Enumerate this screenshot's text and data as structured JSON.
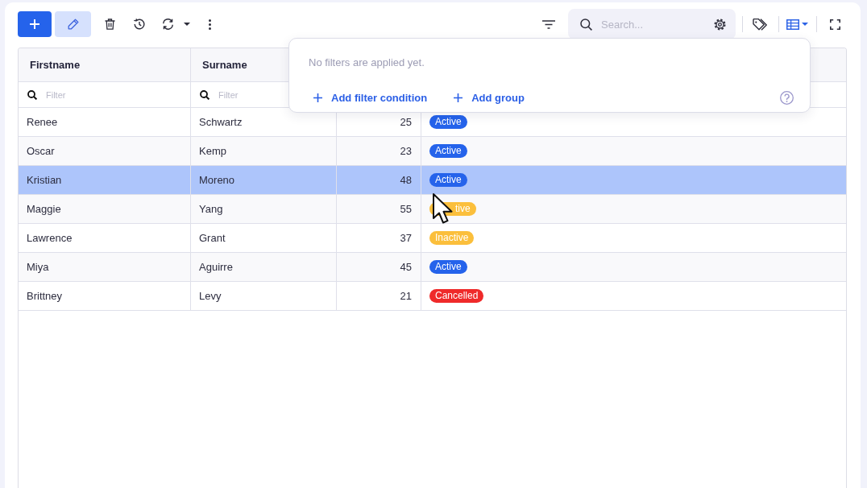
{
  "toolbar": {
    "search": {
      "placeholder": "Search..."
    }
  },
  "filter_popup": {
    "message": "No filters are applied yet.",
    "actions": [
      {
        "label": "Add filter condition"
      },
      {
        "label": "Add group"
      }
    ]
  },
  "table": {
    "columns": [
      {
        "label": "Firstname",
        "filter_placeholder": "Filter"
      },
      {
        "label": "Surname",
        "filter_placeholder": "Filter"
      }
    ],
    "rows": [
      {
        "firstname": "Renee",
        "surname": "Schwartz",
        "column_3": "25",
        "column_4": {
          "label": "Active",
          "color": "#2563eb",
          "covered": false
        },
        "selected": false
      },
      {
        "firstname": "Oscar",
        "surname": "Kemp",
        "column_3": "23",
        "column_4": {
          "label": "Active",
          "color": "#2563eb",
          "covered": false
        },
        "selected": false
      },
      {
        "firstname": "Kristian",
        "surname": "Moreno",
        "column_3": "48",
        "column_4": {
          "label": "Active",
          "color": "#2563eb",
          "covered": false
        },
        "selected": true
      },
      {
        "firstname": "Maggie",
        "surname": "Yang",
        "column_3": "55",
        "column_4": {
          "label": "tive",
          "color": "#fbbf3c",
          "covered": true
        },
        "selected": false
      },
      {
        "firstname": "Lawrence",
        "surname": "Grant",
        "column_3": "37",
        "column_4": {
          "label": "Inactive",
          "color": "#fbbf3c",
          "covered": false
        },
        "selected": false
      },
      {
        "firstname": "Miya",
        "surname": "Aguirre",
        "column_3": "45",
        "column_4": {
          "label": "Active",
          "color": "#2563eb",
          "covered": false
        },
        "selected": false
      },
      {
        "firstname": "Brittney",
        "surname": "Levy",
        "column_3": "21",
        "column_4": {
          "label": "Cancelled",
          "color": "#ef2a2a",
          "covered": false
        },
        "selected": false
      }
    ]
  }
}
